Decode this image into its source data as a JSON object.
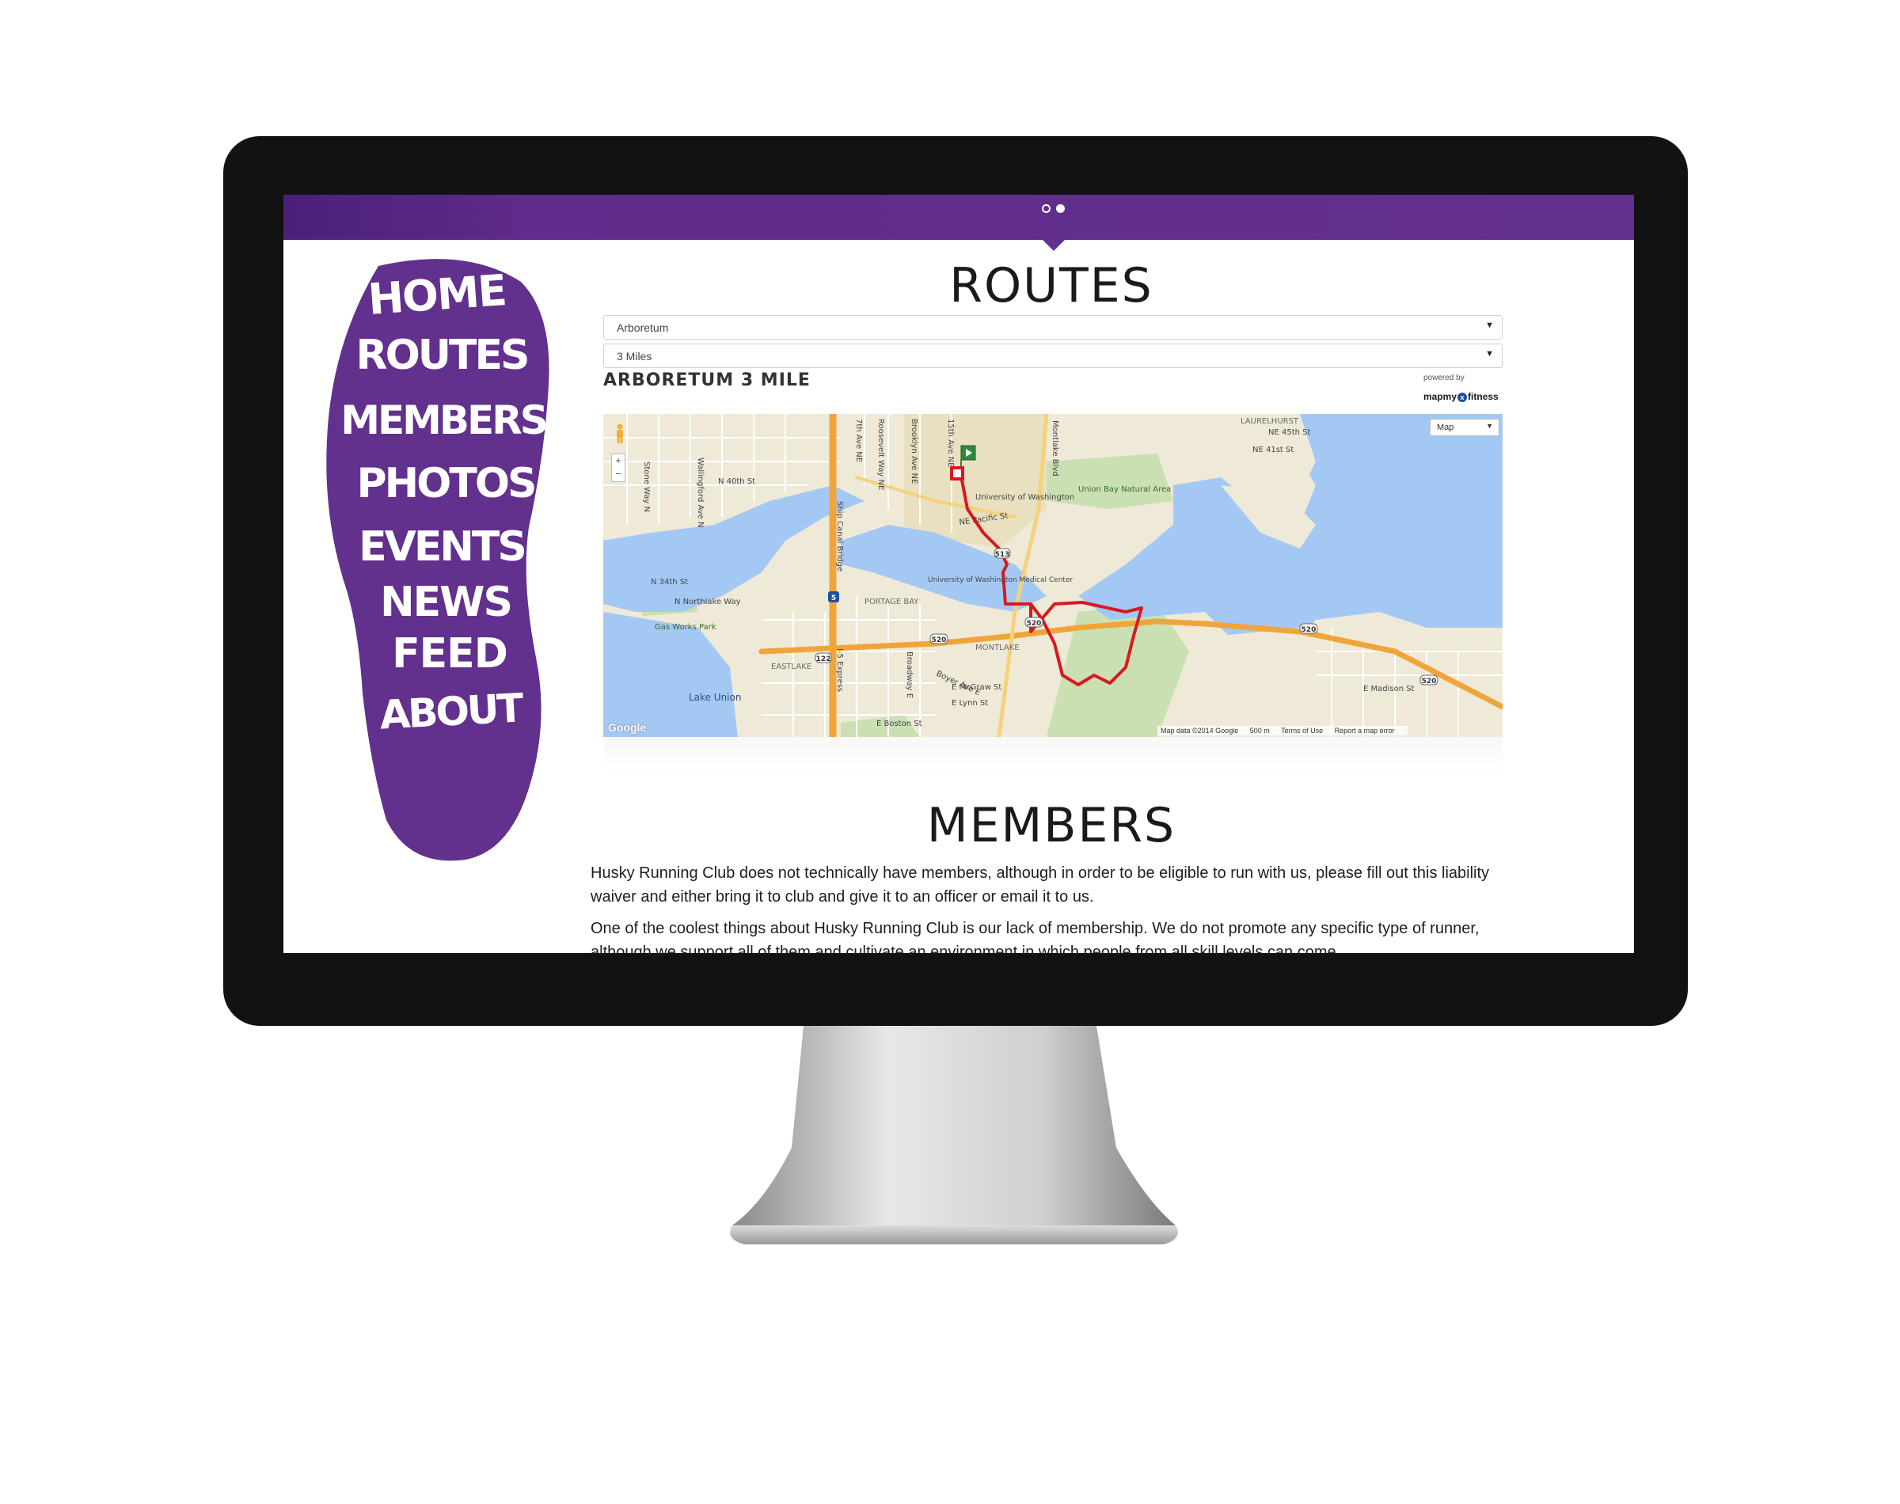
{
  "header": {
    "slide_indicator": {
      "total": 2,
      "active_index": 1
    }
  },
  "nav": {
    "items": [
      {
        "label": "HOME"
      },
      {
        "label": "ROUTES"
      },
      {
        "label": "MEMBERS"
      },
      {
        "label": "PHOTOS"
      },
      {
        "label": "EVENTS"
      },
      {
        "label": "NEWS"
      },
      {
        "label": "FEED"
      },
      {
        "label": "ABOUT"
      }
    ],
    "color": "#62308d"
  },
  "routes": {
    "title": "ROUTES",
    "area_select": {
      "value": "Arboretum"
    },
    "distance_select": {
      "value": "3 Miles"
    },
    "route_name": "ARBORETUM 3 MILE",
    "powered_by": "powered by",
    "provider": {
      "prefix": "mapmy",
      "mark": "x",
      "suffix": "fitness"
    },
    "map": {
      "type_select": "Map",
      "zoom_in": "+",
      "zoom_out": "−",
      "attribution": "Google",
      "map_data": "Map data ©2014 Google",
      "scale": "500 m",
      "terms": "Terms of Use",
      "report": "Report a map error",
      "labels": {
        "stone_way": "Stone Way N",
        "wallingford": "Wallingford Ave N",
        "n40th": "N 40th St",
        "n34th": "N 34th St",
        "northlake": "N Northlake Way",
        "gasworks": "Gas Works Park",
        "lake_union": "Lake Union",
        "ship_canal": "Ship Canal Bridge",
        "portage_bay": "PORTAGE BAY",
        "eastlake": "EASTLAKE",
        "montlake": "MONTLAKE",
        "uw": "University of Washington",
        "uwmc": "University of Washington Medical Center",
        "union_bay": "Union Bay Natural Area",
        "laurelhurst": "LAURELHURST",
        "ne45th": "NE 45th St",
        "ne41st": "NE 41st St",
        "ne_pacific": "NE Pacific St",
        "montlake_blvd": "Montlake Blvd",
        "roosevelt": "Roosevelt Way NE",
        "seventh": "7th Ave NE",
        "brooklyn": "Brooklyn Ave NE",
        "fifteenth": "15th Ave NE",
        "i5": "I-5 Express",
        "boyer": "Boyer Ave E",
        "e_mcgraw": "E McGraw St",
        "e_lynn": "E Lynn St",
        "e_boston": "E Boston St",
        "broadway": "Broadway E",
        "e_madison": "E Madison St",
        "shield_520a": "520",
        "shield_520b": "520",
        "shield_520c": "520",
        "shield_520d": "520",
        "shield_5": "5",
        "shield_513": "513",
        "shield_122": "122"
      }
    }
  },
  "members": {
    "title": "MEMBERS",
    "paragraph_1": "Husky Running Club does not technically have members, although in order to be eligible to run with us, please fill out this liability waiver and either bring it to club and give it to an officer or email it to us.",
    "paragraph_2": "One of the coolest things about Husky Running Club is our lack of membership. We do not promote any specific type of runner, although we support all of them and cultivate an environment in which people from all skill levels can come"
  },
  "colors": {
    "brand_purple": "#62308d",
    "route_red": "#d71920",
    "water": "#a4c8f4",
    "land": "#f0ead8",
    "highway": "#f0a53a"
  }
}
